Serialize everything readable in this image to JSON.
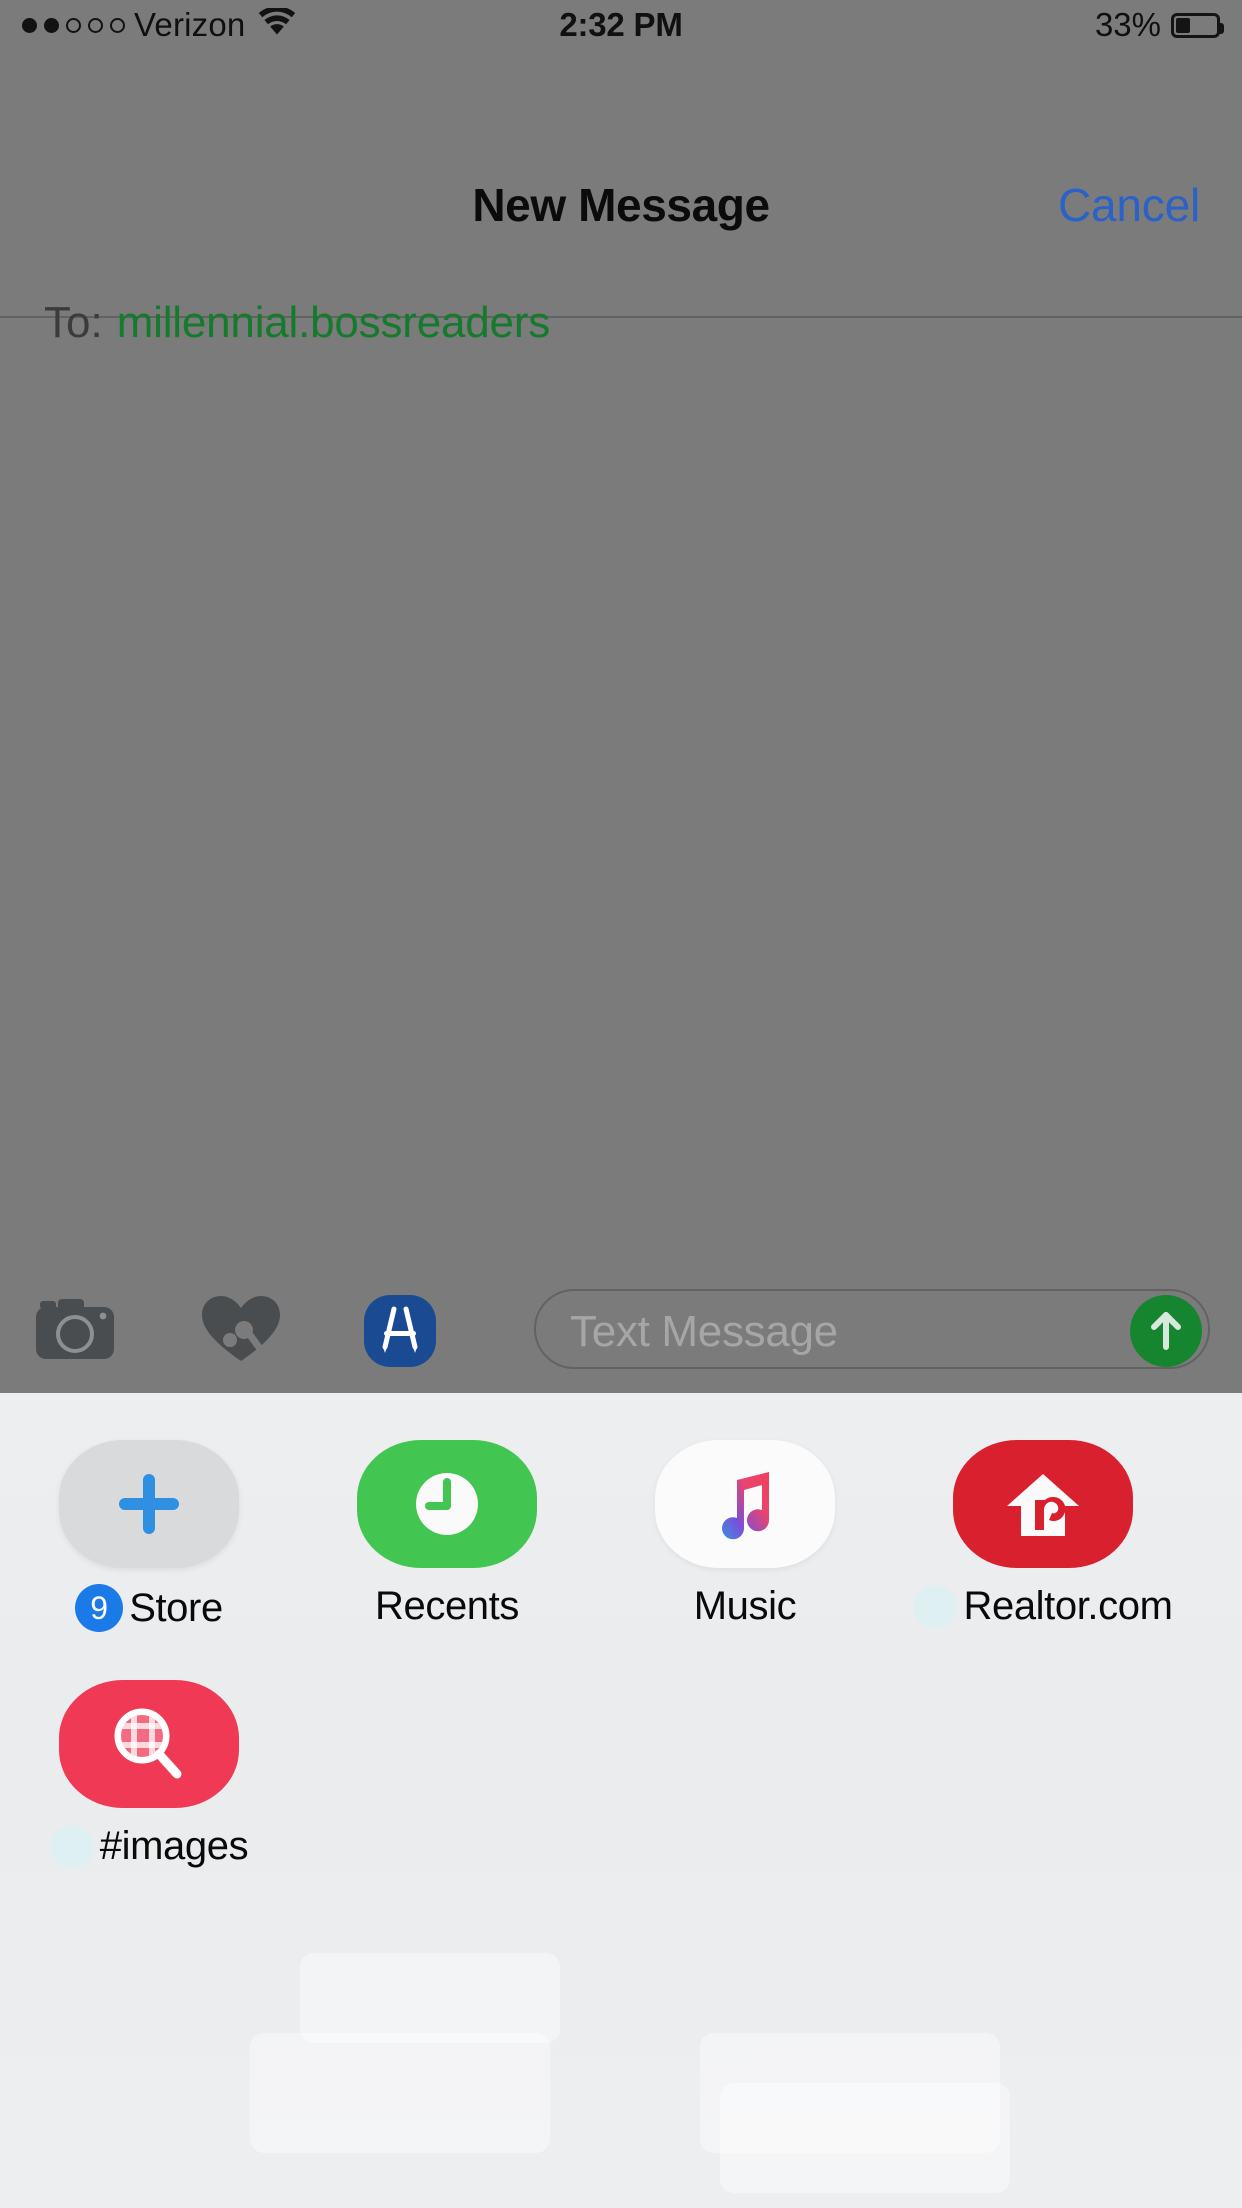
{
  "status_bar": {
    "signal_dots_filled": 2,
    "signal_dots_total": 5,
    "carrier": "Verizon",
    "wifi_icon": "wifi-icon",
    "time": "2:32 PM",
    "battery_percent": "33%",
    "battery_level": 33
  },
  "nav": {
    "title": "New Message",
    "cancel_label": "Cancel"
  },
  "recipient": {
    "to_label": "To:",
    "value": "millennial.bossreaders",
    "value_color": "#147a2c"
  },
  "toolbar": {
    "camera_icon": "camera-icon",
    "digital_touch_icon": "heart-hand-icon",
    "app_store_icon": "app-store-icon",
    "message_placeholder": "Text Message",
    "message_value": "",
    "send_icon": "arrow-up-icon",
    "send_color": "#16852f"
  },
  "app_drawer": {
    "apps": [
      {
        "label": "Store",
        "icon": "plus-icon",
        "icon_bg": "#d9dadc",
        "badge": "9",
        "badge_color": "#1a7ae8",
        "badge_style": "blue"
      },
      {
        "label": "Recents",
        "icon": "clock-icon",
        "icon_bg": "#43c552",
        "badge": "",
        "badge_style": "none"
      },
      {
        "label": "Music",
        "icon": "music-note-icon",
        "icon_bg": "#fbfbfb",
        "badge": "",
        "badge_style": "none"
      },
      {
        "label": "Realtor.com",
        "icon": "house-r-icon",
        "icon_bg": "#d9202e",
        "badge": "",
        "badge_style": "pale"
      },
      {
        "label": "#images",
        "icon": "magnifier-grid-icon",
        "icon_bg": "#f03a55",
        "badge": "",
        "badge_style": "pale"
      }
    ]
  }
}
